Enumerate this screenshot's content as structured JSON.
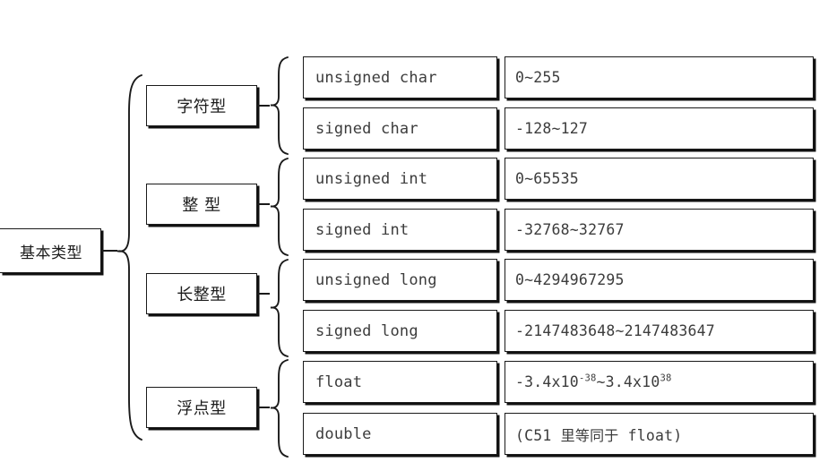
{
  "diagram": {
    "title": "基本类型",
    "root": {
      "label": "基本类型"
    },
    "categories": [
      {
        "label": "字符型"
      },
      {
        "label": "整 型"
      },
      {
        "label": "长整型"
      },
      {
        "label": "浮点型"
      }
    ],
    "rows": [
      {
        "type": "unsigned char",
        "range": "0~255",
        "category": "字符型"
      },
      {
        "type": "signed char",
        "range": "-128~127",
        "category": "字符型"
      },
      {
        "type": "unsigned int",
        "range": "0~65535",
        "category": "整 型"
      },
      {
        "type": "signed int",
        "range": "-32768~32767",
        "category": "整 型"
      },
      {
        "type": "unsigned long",
        "range": "0~4294967295",
        "category": "长整型"
      },
      {
        "type": "signed long",
        "range": "-2147483648~2147483647",
        "category": "长整型"
      },
      {
        "type": "float",
        "range": "-3.4x10^-38~3.4x10^38",
        "category": "浮点型"
      },
      {
        "type": "double",
        "range": "(C51 里等同于 float)",
        "category": "浮点型"
      }
    ],
    "float_range_parts": {
      "prefix": "-3.4x10",
      "exp_low": "-38",
      "middle": "~3.4x10",
      "exp_high": "38"
    },
    "double_range_parts": {
      "open": "(C51 ",
      "cjk": "里等同于",
      "close": " float)"
    },
    "colors": {
      "border": "#1a1a1a",
      "shadow": "#111111",
      "background": "#ffffff",
      "mono_text": "#3c3c3c",
      "cjk_text": "#1c1c1c"
    }
  }
}
